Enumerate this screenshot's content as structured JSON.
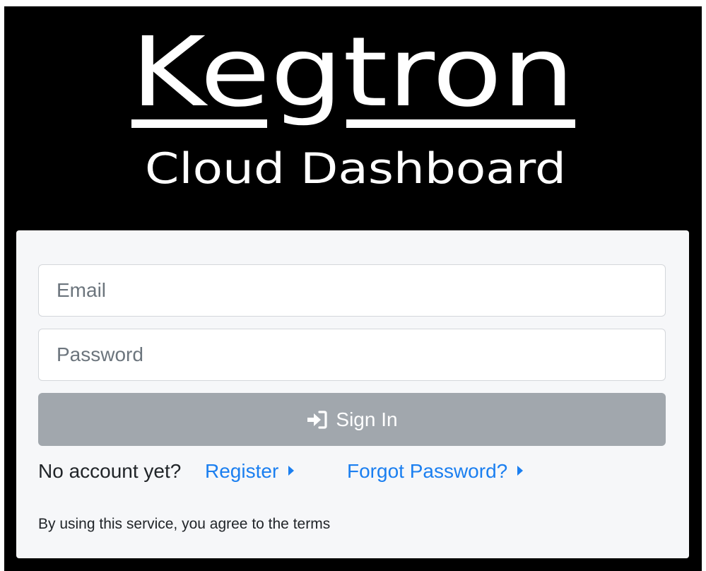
{
  "logo": {
    "brand": "Kegtron",
    "subtitle": "Cloud Dashboard"
  },
  "login_form": {
    "email_placeholder": "Email",
    "email_value": "",
    "password_placeholder": "Password",
    "password_value": "",
    "sign_in_label": "Sign In",
    "sign_in_icon": "sign-in-icon"
  },
  "links": {
    "no_account_prompt": "No account yet?",
    "register_label": "Register",
    "forgot_password_label": "Forgot Password?"
  },
  "terms_text": "By using this service, you agree to the terms",
  "colors": {
    "page_background": "#000000",
    "card_background": "#f6f7f9",
    "button_background": "#a1a7ad",
    "link": "#1b7ff0"
  }
}
